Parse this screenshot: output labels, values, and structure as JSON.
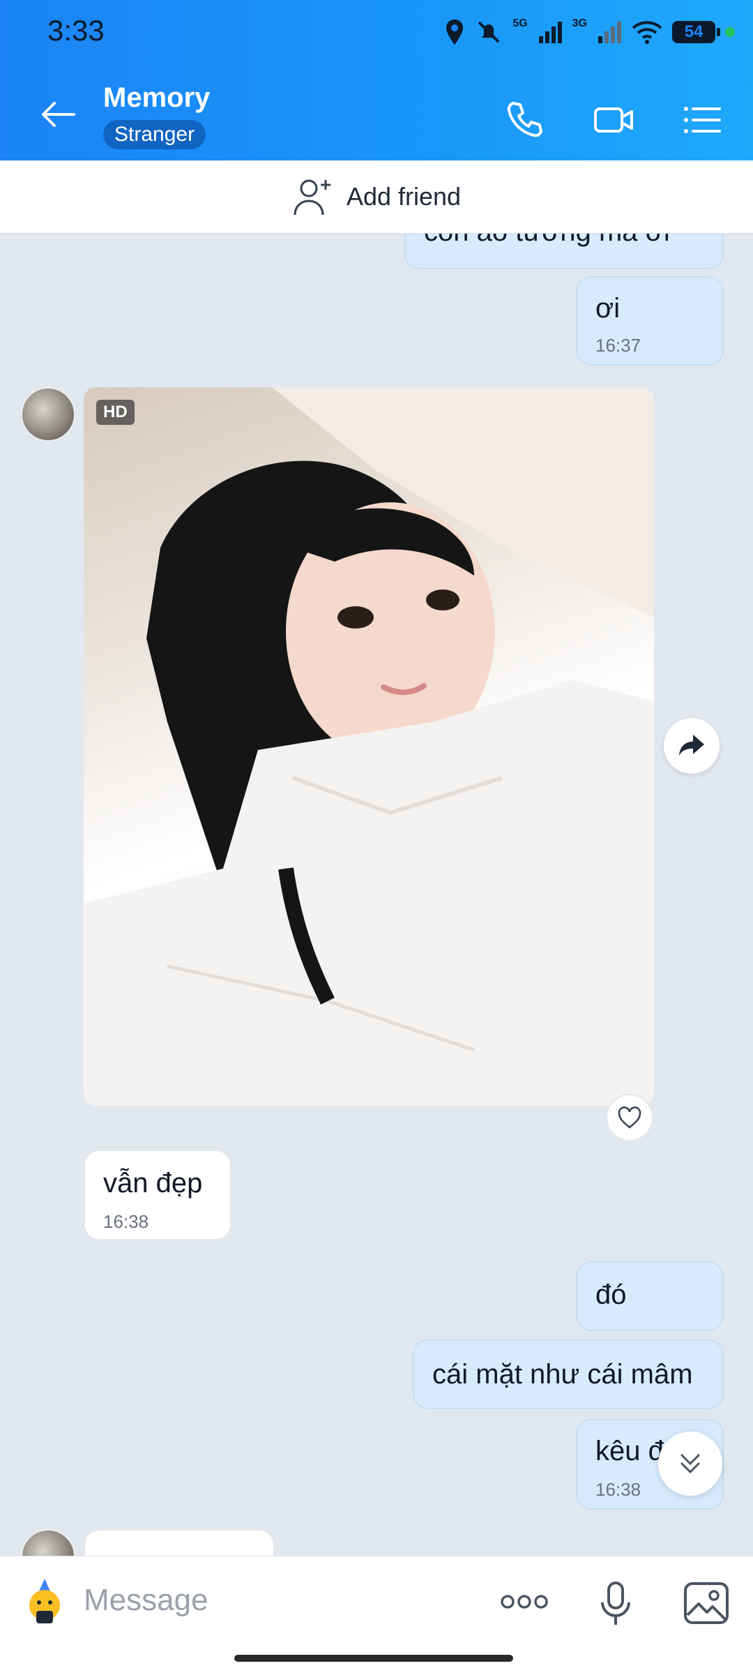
{
  "status": {
    "time": "3:33",
    "net1": "5G",
    "net2": "3G",
    "battery": "54"
  },
  "header": {
    "title": "Memory",
    "badge": "Stranger"
  },
  "add_friend": {
    "label": "Add friend"
  },
  "messages": [
    {
      "side": "me",
      "text": "còn ảo tưởng mà ơi",
      "time": ""
    },
    {
      "side": "me",
      "text": "ơi",
      "time": "16:37"
    },
    {
      "side": "them",
      "type": "photo",
      "badge": "HD"
    },
    {
      "side": "them",
      "text": "vẫn đẹp",
      "time": "16:38"
    },
    {
      "side": "me",
      "text": "đó",
      "time": ""
    },
    {
      "side": "me",
      "text": "cái mặt như cái mâm",
      "time": ""
    },
    {
      "side": "me",
      "text": "kêu đ",
      "time": "16:38"
    },
    {
      "side": "them",
      "text": "",
      "time": ""
    }
  ],
  "composer": {
    "placeholder": "Message"
  },
  "colors": {
    "header_start": "#1b83f5",
    "header_end": "#1fa9fb",
    "my_bubble": "#d7ebfc",
    "chat_bg": "#e2e8f0"
  }
}
